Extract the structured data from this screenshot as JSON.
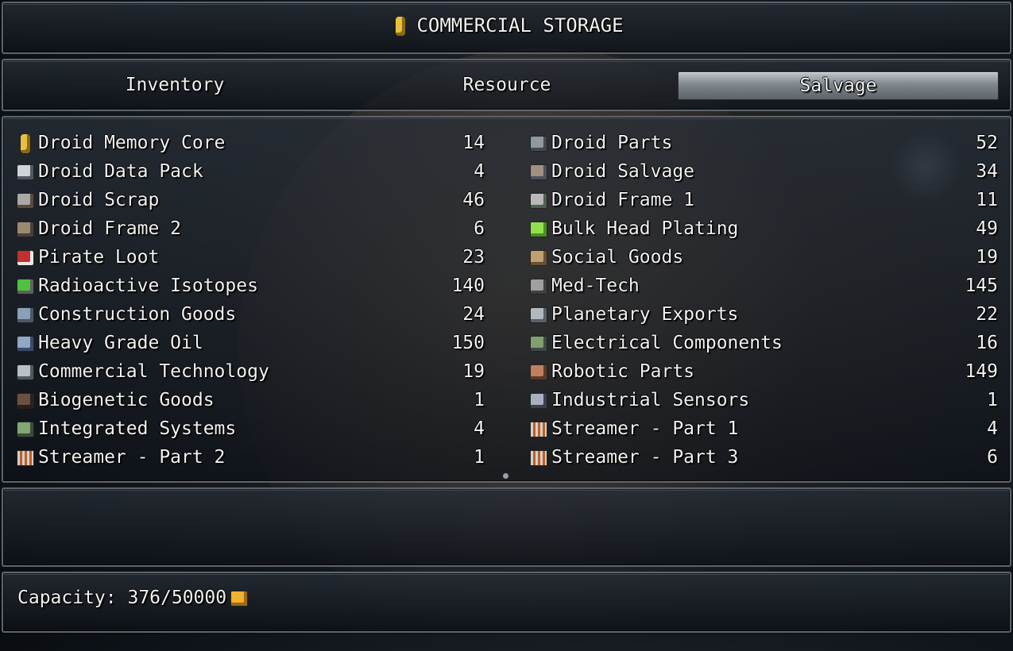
{
  "window": {
    "title": "COMMERCIAL STORAGE",
    "title_icon": "battery-icon"
  },
  "tabs": [
    {
      "label": "Inventory",
      "active": false
    },
    {
      "label": "Resource",
      "active": false
    },
    {
      "label": "Salvage",
      "active": true
    }
  ],
  "items_left": [
    {
      "name": "Droid Memory Core",
      "qty": "14",
      "icon": "battery-icon",
      "c1": "#e8c040",
      "c2": "#8a6a10"
    },
    {
      "name": "Droid Data Pack",
      "qty": "4",
      "icon": "data-pack-icon",
      "c1": "#d0d4d8",
      "c2": "#505860"
    },
    {
      "name": "Droid Scrap",
      "qty": "46",
      "icon": "scrap-icon",
      "c1": "#a8a8a8",
      "c2": "#5a4a3a"
    },
    {
      "name": "Droid Frame 2",
      "qty": "6",
      "icon": "droid-frame-icon",
      "c1": "#9a8a70",
      "c2": "#4a4038"
    },
    {
      "name": "Pirate Loot",
      "qty": "23",
      "icon": "loot-icon",
      "c1": "#c03030",
      "c2": "#e8e8e8"
    },
    {
      "name": "Radioactive Isotopes",
      "qty": "140",
      "icon": "isotope-icon",
      "c1": "#50c040",
      "c2": "#606060"
    },
    {
      "name": "Construction Goods",
      "qty": "24",
      "icon": "construction-icon",
      "c1": "#8aa0b8",
      "c2": "#4a5868"
    },
    {
      "name": "Heavy Grade Oil",
      "qty": "150",
      "icon": "oil-barrels-icon",
      "c1": "#90a8c8",
      "c2": "#3a4a68"
    },
    {
      "name": "Commercial Technology",
      "qty": "19",
      "icon": "satellite-icon",
      "c1": "#b8c0c8",
      "c2": "#505860"
    },
    {
      "name": "Biogenetic Goods",
      "qty": "1",
      "icon": "biogenetic-icon",
      "c1": "#6a5040",
      "c2": "#2a2018"
    },
    {
      "name": "Integrated Systems",
      "qty": "4",
      "icon": "circuit-icon",
      "c1": "#80a870",
      "c2": "#3a4a38"
    },
    {
      "name": "Streamer - Part 2",
      "qty": "1",
      "icon": "crate-icon",
      "c1": "#d0d0d0",
      "c2": "#c06020"
    }
  ],
  "items_right": [
    {
      "name": "Droid Parts",
      "qty": "52",
      "icon": "droid-parts-icon",
      "c1": "#9098a0",
      "c2": "#404850"
    },
    {
      "name": "Droid Salvage",
      "qty": "34",
      "icon": "salvage-icon",
      "c1": "#a09080",
      "c2": "#505060"
    },
    {
      "name": "Droid Frame 1",
      "qty": "11",
      "icon": "droid-head-icon",
      "c1": "#b8b8b8",
      "c2": "#506050"
    },
    {
      "name": "Bulk Head Plating",
      "qty": "49",
      "icon": "green-cube-icon",
      "c1": "#90e050",
      "c2": "#4a9020"
    },
    {
      "name": "Social Goods",
      "qty": "19",
      "icon": "box-icon",
      "c1": "#c0a070",
      "c2": "#6a5030"
    },
    {
      "name": "Med-Tech",
      "qty": "145",
      "icon": "med-tech-icon",
      "c1": "#a0a0a0",
      "c2": "#404040"
    },
    {
      "name": "Planetary Exports",
      "qty": "22",
      "icon": "container-icon",
      "c1": "#b0b8c0",
      "c2": "#5a6068"
    },
    {
      "name": "Electrical Components",
      "qty": "16",
      "icon": "components-icon",
      "c1": "#80a070",
      "c2": "#404848"
    },
    {
      "name": "Robotic Parts",
      "qty": "149",
      "icon": "robotic-parts-icon",
      "c1": "#c08060",
      "c2": "#5a3a28"
    },
    {
      "name": "Industrial Sensors",
      "qty": "1",
      "icon": "sensor-icon",
      "c1": "#a8b0c0",
      "c2": "#3a4050"
    },
    {
      "name": "Streamer - Part 1",
      "qty": "4",
      "icon": "crate-icon",
      "c1": "#d0d0d0",
      "c2": "#c06020"
    },
    {
      "name": "Streamer - Part 3",
      "qty": "6",
      "icon": "crate-icon",
      "c1": "#d0d0d0",
      "c2": "#c06020"
    }
  ],
  "capacity": {
    "label": "Capacity: 376/50000",
    "icon": "gold-crate-icon"
  }
}
